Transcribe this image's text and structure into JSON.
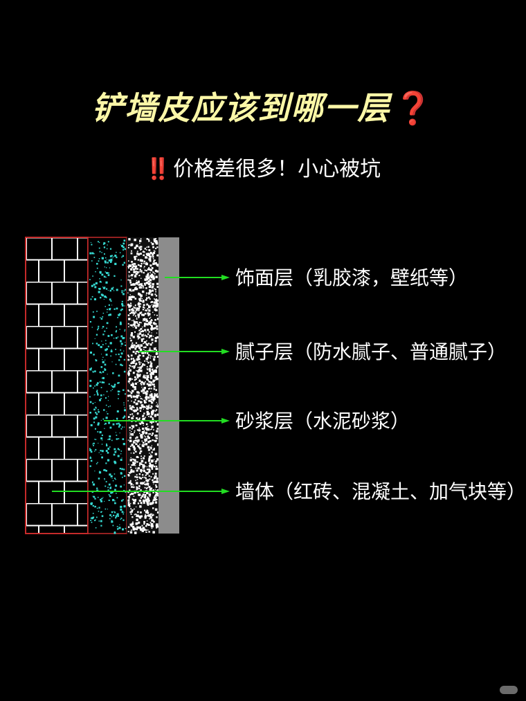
{
  "header": {
    "title": "铲墙皮应该到哪一层",
    "title_mark": "❓",
    "subtitle_mark": "‼️",
    "subtitle": "价格差很多！小心被坑"
  },
  "layers": [
    {
      "id": "finish",
      "label": "饰面层（乳胶漆，壁纸等）"
    },
    {
      "id": "putty",
      "label": "腻子层（防水腻子、普通腻子）"
    },
    {
      "id": "mortar",
      "label": "砂浆层（水泥砂浆）"
    },
    {
      "id": "wall",
      "label": "墙体（红砖、混凝土、加气块等）"
    }
  ],
  "colors": {
    "background": "#000000",
    "title": "#fbf7a7",
    "accent_red": "#e5252b",
    "leader_line": "#22dd22",
    "brick_outline": "#c62a2a",
    "brick_mortar": "#ffffff",
    "mortar_speckle": "#36d8d0",
    "putty_speckle": "#ffffff",
    "finish_surface": "#8c8c8c"
  },
  "watermark": {
    "icon": "app-watermark-icon"
  }
}
